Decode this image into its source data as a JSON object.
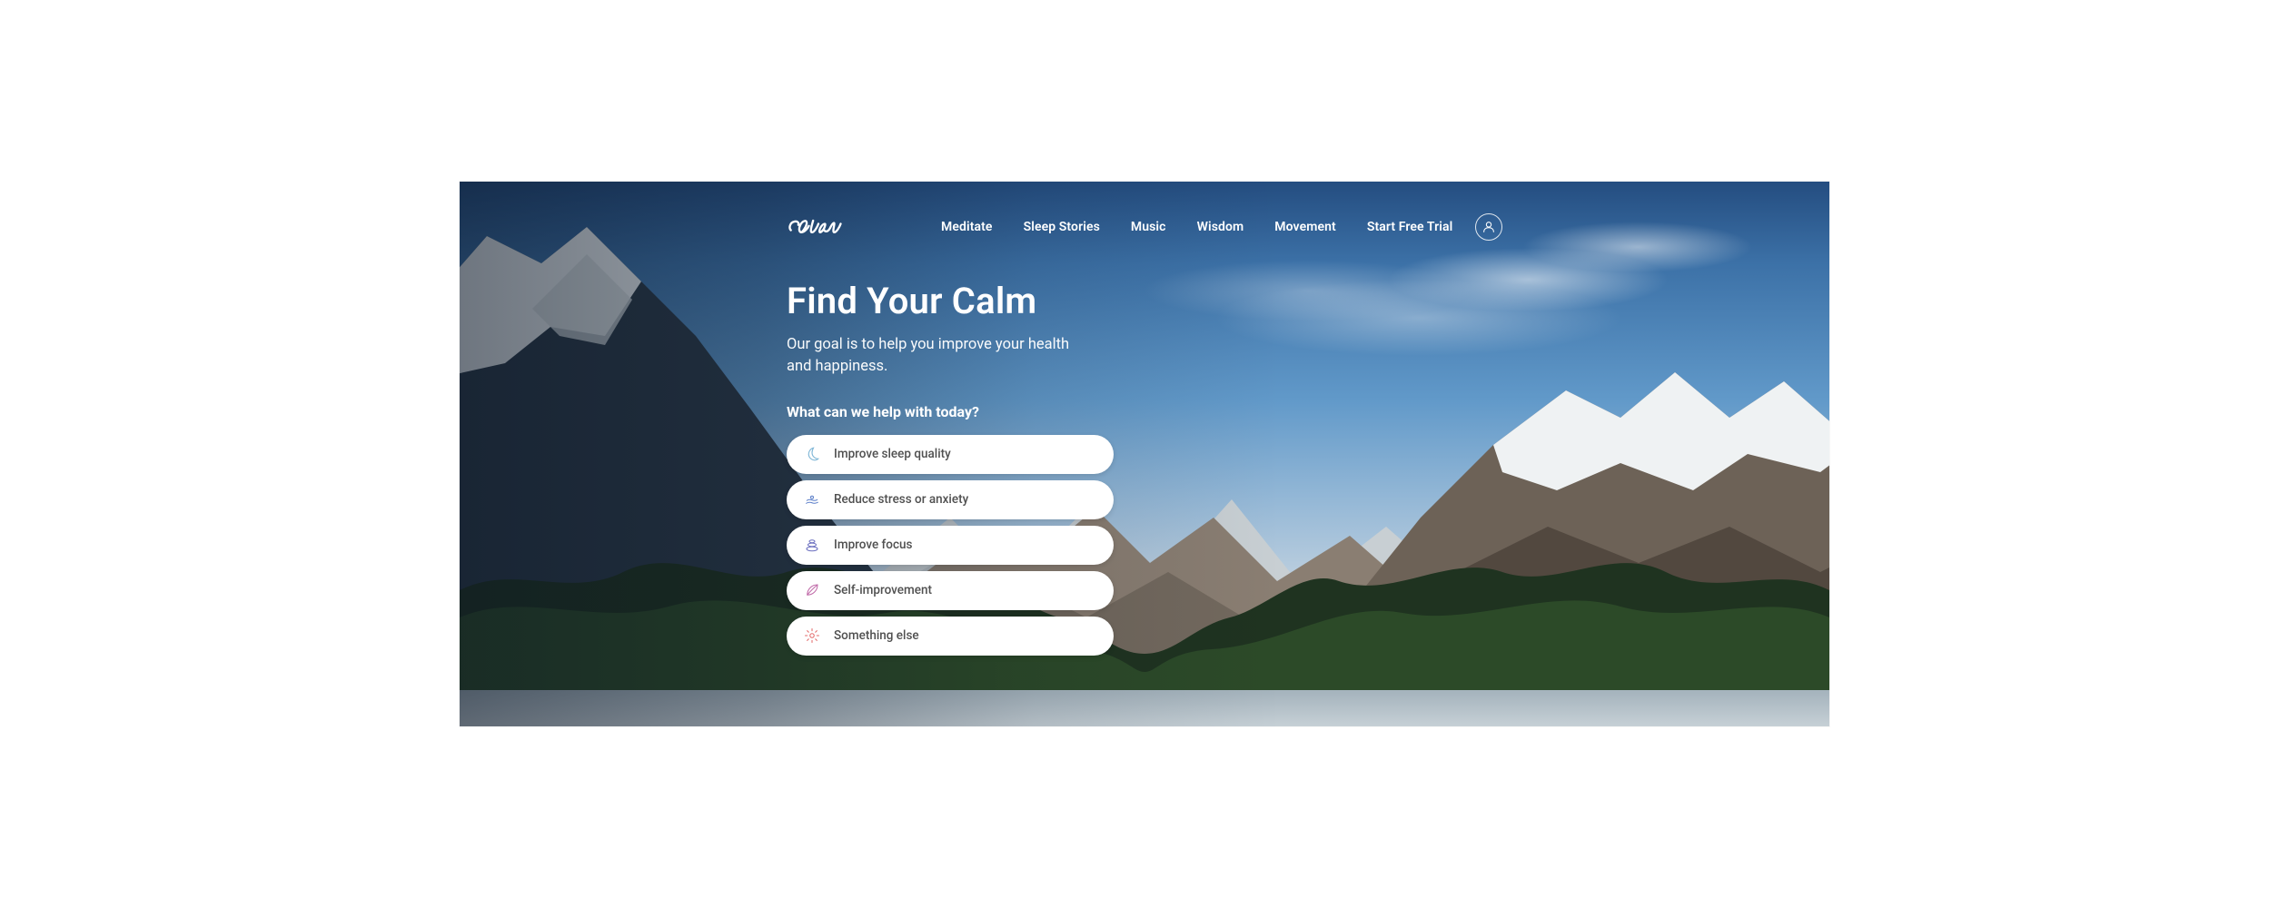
{
  "brand": {
    "name": "Calm"
  },
  "nav": {
    "items": [
      {
        "label": "Meditate"
      },
      {
        "label": "Sleep Stories"
      },
      {
        "label": "Music"
      },
      {
        "label": "Wisdom"
      },
      {
        "label": "Movement"
      },
      {
        "label": "Start Free Trial"
      }
    ]
  },
  "hero": {
    "title": "Find Your Calm",
    "subtitle": "Our goal is to help you improve your health and happiness.",
    "prompt": "What can we help with today?",
    "options": [
      {
        "icon": "moon-icon",
        "icon_color": "#7fb6d6",
        "label": "Improve sleep quality"
      },
      {
        "icon": "ripple-icon",
        "icon_color": "#5c7fc9",
        "label": "Reduce stress or anxiety"
      },
      {
        "icon": "stones-icon",
        "icon_color": "#6b6fbf",
        "label": "Improve focus"
      },
      {
        "icon": "leaf-icon",
        "icon_color": "#c06aa8",
        "label": "Self-improvement"
      },
      {
        "icon": "gear-icon",
        "icon_color": "#e36a6a",
        "label": "Something else"
      }
    ]
  },
  "colors": {
    "sky_top": "#244d80",
    "sky_bottom": "#cbd7df",
    "text_on_dark": "#ffffff",
    "pill_bg": "#ffffff",
    "pill_text": "#505050"
  }
}
